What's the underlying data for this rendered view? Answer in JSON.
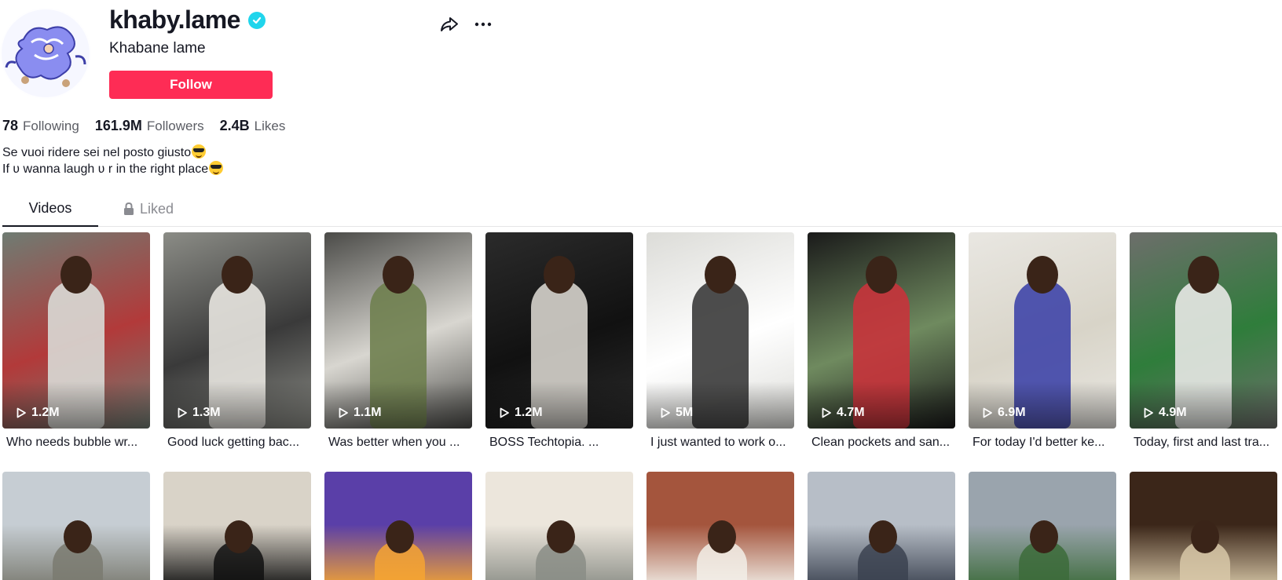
{
  "profile": {
    "username": "khaby.lame",
    "nickname": "Khabane lame",
    "follow_label": "Follow",
    "verified": true,
    "icons": {
      "verified": "verified-badge-icon",
      "share": "share-icon",
      "more": "more-icon"
    }
  },
  "stats": [
    {
      "value": "78",
      "label": "Following"
    },
    {
      "value": "161.9M",
      "label": "Followers"
    },
    {
      "value": "2.4B",
      "label": "Likes"
    }
  ],
  "bio": {
    "line1": "Se vuoi ridere sei nel posto giusto",
    "line2": "If ʋ wanna laugh ʋ r in the right place",
    "emoji": "smiling-face-with-sunglasses"
  },
  "tabs": {
    "videos": "Videos",
    "liked": "Liked"
  },
  "videos": [
    {
      "views": "1.2M",
      "caption": "Who needs bubble wr...",
      "colors": [
        "#6f7c73",
        "#d9dad6",
        "#b23a3a"
      ]
    },
    {
      "views": "1.3M",
      "caption": "Good luck getting bac...",
      "colors": [
        "#8b8c86",
        "#e8e6e0",
        "#3a3a3a"
      ]
    },
    {
      "views": "1.1M",
      "caption": "Was better when you ...",
      "colors": [
        "#4b4b48",
        "#6f7f4f",
        "#d8d6d0"
      ]
    },
    {
      "views": "1.2M",
      "caption": "BOSS Techtopia. ...",
      "colors": [
        "#2b2b2b",
        "#d6d3cc",
        "#111111"
      ]
    },
    {
      "views": "5M",
      "caption": "I just wanted to work o...",
      "colors": [
        "#dcdcd8",
        "#3a3a3a",
        "#ffffff"
      ]
    },
    {
      "views": "4.7M",
      "caption": "Clean pockets and san...",
      "colors": [
        "#1a1a1a",
        "#c8333b",
        "#6f8a5f"
      ]
    },
    {
      "views": "6.9M",
      "caption": "For today I'd better ke...",
      "colors": [
        "#e9e7e2",
        "#3f45a8",
        "#d8d4c8"
      ]
    },
    {
      "views": "4.9M",
      "caption": "Today, first and last tra...",
      "colors": [
        "#6d6e6b",
        "#e8e8e6",
        "#2f7d3b"
      ]
    }
  ],
  "videos_row2": [
    {
      "colors": [
        "#c6cdd3",
        "#7a7a70"
      ]
    },
    {
      "colors": [
        "#d9d3c8",
        "#111111"
      ]
    },
    {
      "colors": [
        "#5a3fa8",
        "#f6a531"
      ]
    },
    {
      "colors": [
        "#ece6dc",
        "#8a8d86"
      ]
    },
    {
      "colors": [
        "#a4553d",
        "#f2efe8"
      ]
    },
    {
      "colors": [
        "#b7bec7",
        "#3b4250"
      ]
    },
    {
      "colors": [
        "#9aa4ad",
        "#3c6b3a"
      ]
    },
    {
      "colors": [
        "#3b2619",
        "#d8c8a8"
      ]
    }
  ]
}
